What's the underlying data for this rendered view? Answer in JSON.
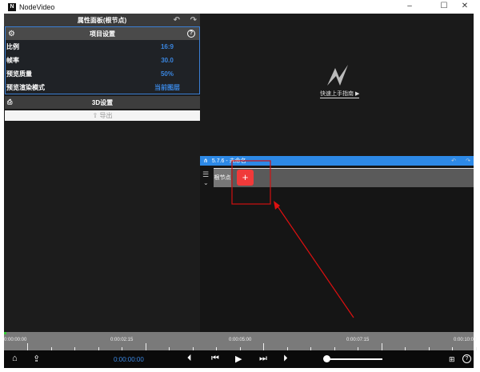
{
  "window": {
    "title": "NodeVideo",
    "logo": "N",
    "controls": [
      "–",
      "☐",
      "✕"
    ]
  },
  "panel": {
    "title": "属性面板(根节点)",
    "undo": "↶",
    "redo": "↷"
  },
  "project": {
    "title": "项目设置",
    "help": "?",
    "rows": [
      {
        "label": "比例",
        "value": "16:9"
      },
      {
        "label": "帧率",
        "value": "30.0"
      },
      {
        "label": "预览质量",
        "value": "50%"
      },
      {
        "label": "预览渲染模式",
        "value": "当前图层"
      }
    ]
  },
  "settings3d": {
    "title": "3D设置"
  },
  "export": {
    "label": "导出",
    "icon": "⇧"
  },
  "preview": {
    "guide_link": "快速上手指南 ▶"
  },
  "track_header": {
    "title": "5.7.6 - 未命名",
    "undo": "↶",
    "redo": "↷"
  },
  "track": {
    "root_node": "根节点",
    "add": "+"
  },
  "ruler": {
    "labels": [
      "0:00:00:00",
      "0:00:02:15",
      "0:00:05:00",
      "0:00:07:15",
      "0:00:10:00"
    ]
  },
  "bottom": {
    "timecode": "0:00:00:00",
    "zoom_level": 0
  }
}
